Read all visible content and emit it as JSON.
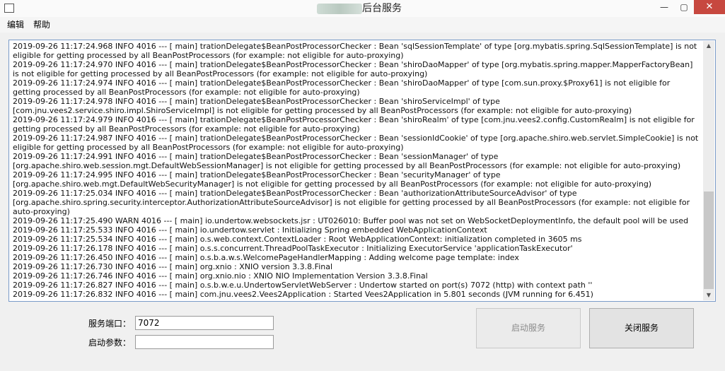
{
  "window": {
    "title": "后台服务",
    "minimize": "—",
    "maximize": "▢",
    "close": "✕"
  },
  "menu": [
    {
      "label": "编辑"
    },
    {
      "label": "帮助"
    }
  ],
  "log": {
    "lines": [
      "2019-09-26 11:17:24.968  INFO 4016 --- [           main] trationDelegate$BeanPostProcessorChecker : Bean 'sqlSessionTemplate' of type [org.mybatis.spring.SqlSessionTemplate] is not eligible for getting processed by all BeanPostProcessors (for example: not eligible for auto-proxying)",
      "2019-09-26 11:17:24.970  INFO 4016 --- [           main] trationDelegate$BeanPostProcessorChecker : Bean 'shiroDaoMapper' of type [org.mybatis.spring.mapper.MapperFactoryBean] is not eligible for getting processed by all BeanPostProcessors (for example: not eligible for auto-proxying)",
      "2019-09-26 11:17:24.974  INFO 4016 --- [           main] trationDelegate$BeanPostProcessorChecker : Bean 'shiroDaoMapper' of type [com.sun.proxy.$Proxy61] is not eligible for getting processed by all BeanPostProcessors (for example: not eligible for auto-proxying)",
      "2019-09-26 11:17:24.978  INFO 4016 --- [           main] trationDelegate$BeanPostProcessorChecker : Bean 'shiroServiceImpl' of type [com.jnu.vees2.service.shiro.impl.ShiroServiceImpl] is not eligible for getting processed by all BeanPostProcessors (for example: not eligible for auto-proxying)",
      "2019-09-26 11:17:24.979  INFO 4016 --- [           main] trationDelegate$BeanPostProcessorChecker : Bean 'shiroRealm' of type [com.jnu.vees2.config.CustomRealm] is not eligible for getting processed by all BeanPostProcessors (for example: not eligible for auto-proxying)",
      "2019-09-26 11:17:24.987  INFO 4016 --- [           main] trationDelegate$BeanPostProcessorChecker : Bean 'sessionIdCookie' of type [org.apache.shiro.web.servlet.SimpleCookie] is not eligible for getting processed by all BeanPostProcessors (for example: not eligible for auto-proxying)",
      "2019-09-26 11:17:24.991  INFO 4016 --- [           main] trationDelegate$BeanPostProcessorChecker : Bean 'sessionManager' of type [org.apache.shiro.web.session.mgt.DefaultWebSessionManager] is not eligible for getting processed by all BeanPostProcessors (for example: not eligible for auto-proxying)",
      "2019-09-26 11:17:24.995  INFO 4016 --- [           main] trationDelegate$BeanPostProcessorChecker : Bean 'securityManager' of type [org.apache.shiro.web.mgt.DefaultWebSecurityManager] is not eligible for getting processed by all BeanPostProcessors (for example: not eligible for auto-proxying)",
      "2019-09-26 11:17:25.034  INFO 4016 --- [           main] trationDelegate$BeanPostProcessorChecker : Bean 'authorizationAttributeSourceAdvisor' of type [org.apache.shiro.spring.security.interceptor.AuthorizationAttributeSourceAdvisor] is not eligible for getting processed by all BeanPostProcessors (for example: not eligible for auto-proxying)",
      "2019-09-26 11:17:25.490  WARN 4016 --- [           main] io.undertow.websockets.jsr               : UT026010: Buffer pool was not set on WebSocketDeploymentInfo, the default pool will be used",
      "2019-09-26 11:17:25.533  INFO 4016 --- [           main] io.undertow.servlet                      : Initializing Spring embedded WebApplicationContext",
      "2019-09-26 11:17:25.534  INFO 4016 --- [           main] o.s.web.context.ContextLoader            : Root WebApplicationContext: initialization completed in 3605 ms",
      "2019-09-26 11:17:26.178  INFO 4016 --- [           main] o.s.s.concurrent.ThreadPoolTaskExecutor  : Initializing ExecutorService 'applicationTaskExecutor'",
      "2019-09-26 11:17:26.450  INFO 4016 --- [           main] o.s.b.a.w.s.WelcomePageHandlerMapping    : Adding welcome page template: index",
      "2019-09-26 11:17:26.730  INFO 4016 --- [           main] org.xnio                                 : XNIO version 3.3.8.Final",
      "2019-09-26 11:17:26.746  INFO 4016 --- [           main] org.xnio.nio                             : XNIO NIO Implementation Version 3.3.8.Final",
      "2019-09-26 11:17:26.827  INFO 4016 --- [           main] o.s.b.w.e.u.UndertowServletWebServer     : Undertow started on port(s) 7072 (http) with context path ''",
      "2019-09-26 11:17:26.832  INFO 4016 --- [           main] com.jnu.vees2.Vees2Application           : Started Vees2Application in 5.801 seconds (JVM running for 6.451)"
    ],
    "scroll": {
      "up": "▲",
      "down": "▼"
    }
  },
  "form": {
    "port_label": "服务端口：",
    "port_value": "7072",
    "args_label": "启动参数：",
    "args_value": ""
  },
  "buttons": {
    "start": "启动服务",
    "stop": "关闭服务"
  }
}
